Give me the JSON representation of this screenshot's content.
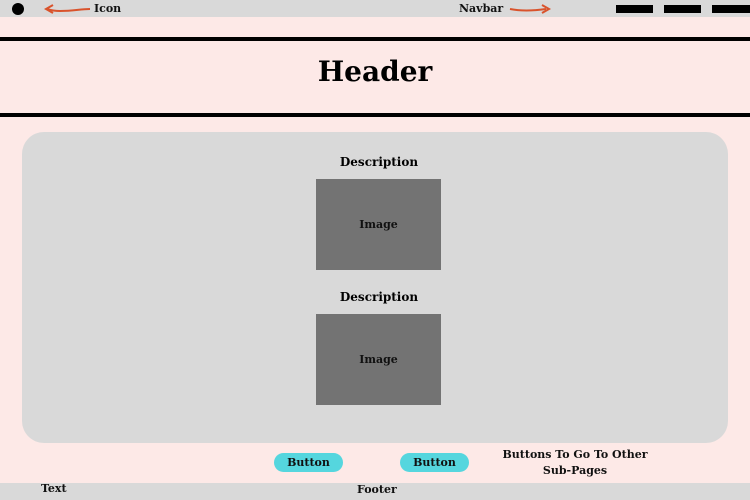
{
  "navbar": {
    "icon_label": "Icon",
    "navbar_label": "Navbar",
    "menu_items": [
      "",
      "",
      ""
    ]
  },
  "header": {
    "title": "Header"
  },
  "content": {
    "items": [
      {
        "description": "Description",
        "image_label": "Image"
      },
      {
        "description": "Description",
        "image_label": "Image"
      }
    ]
  },
  "buttons": {
    "items": [
      "Button",
      "Button"
    ],
    "note": "Buttons To Go To Other Sub-Pages"
  },
  "footer": {
    "left_text": "Text",
    "center_text": "Footer"
  },
  "colors": {
    "page_background": "#fde9e7",
    "panel_gray": "#d9d9d9",
    "image_placeholder": "#737373",
    "button_cyan": "#55d6de",
    "annotation_arrow": "#d9532c"
  }
}
